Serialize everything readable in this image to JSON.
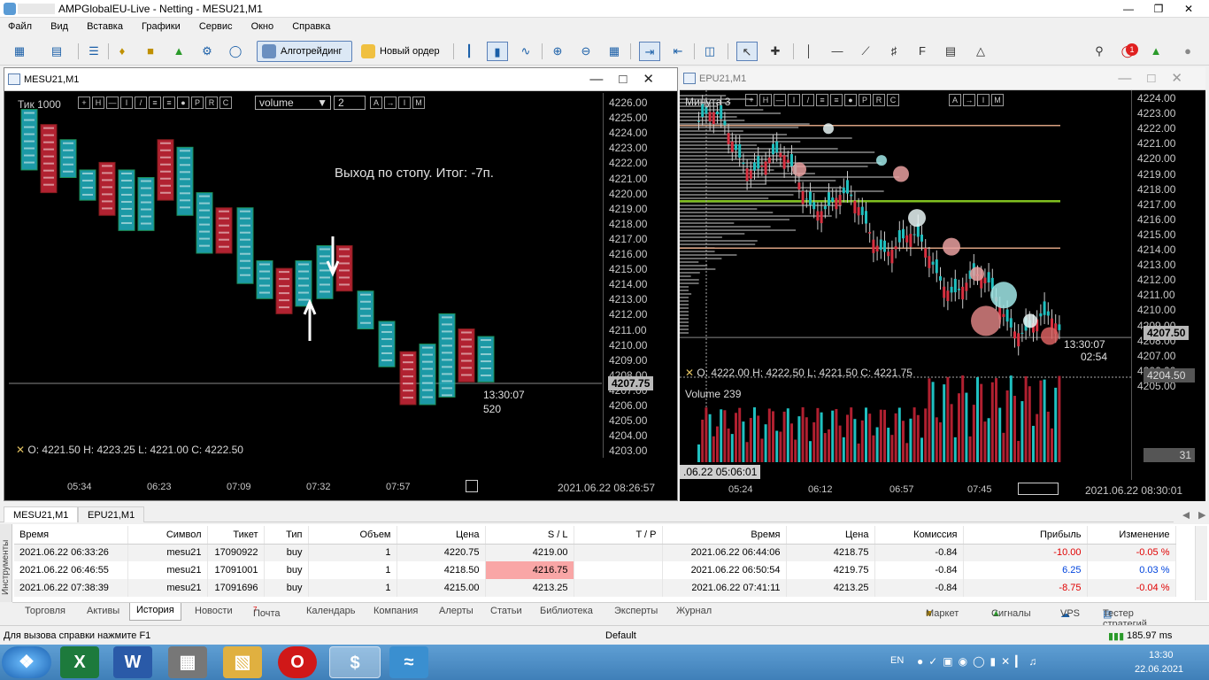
{
  "window_title": "AMPGlobalEU-Live - Netting - MESU21,M1",
  "menu": [
    "Файл",
    "Вид",
    "Вставка",
    "Графики",
    "Сервис",
    "Окно",
    "Справка"
  ],
  "toolbar": {
    "algo": "Алготрейдинг",
    "neworder": "Новый ордер"
  },
  "chart1": {
    "title": "MESU21,M1",
    "label_left": "Тик  1000",
    "indicator": "volume",
    "indicator_val": "2",
    "note": "Выход по стопу. Итог: -7п.",
    "price_axis": [
      "4226.00",
      "4225.00",
      "4224.00",
      "4223.00",
      "4222.00",
      "4221.00",
      "4220.00",
      "4219.00",
      "4218.00",
      "4217.00",
      "4216.00",
      "4215.00",
      "4214.00",
      "4213.00",
      "4212.00",
      "4211.00",
      "4210.00",
      "4209.00",
      "4208.00",
      "4207.00",
      "4206.00",
      "4205.00",
      "4204.00",
      "4203.00"
    ],
    "current_price": "4207.75",
    "countdown_time": "13:30:07",
    "countdown_ticks": "520",
    "ohlc": "O: 4221.50   H: 4223.25   L: 4221.00   C: 4222.50",
    "time_axis": [
      "05:34",
      "06:23",
      "07:09",
      "07:32",
      "07:57"
    ],
    "datetime": "2021.06.22 08:26:57"
  },
  "chart2": {
    "title": "EPU21,M1",
    "label_left": "Минута  3",
    "price_axis": [
      "4224.00",
      "4223.00",
      "4222.00",
      "4221.00",
      "4220.00",
      "4219.00",
      "4218.00",
      "4217.00",
      "4216.00",
      "4215.00",
      "4214.00",
      "4213.00",
      "4212.00",
      "4211.00",
      "4210.00",
      "4209.00",
      "4208.00",
      "4207.00",
      "4206.00",
      "4205.00"
    ],
    "current_price": "4207.50",
    "cross_price": "4204.50",
    "countdown_time": "13:30:07",
    "countdown_timer": "02:54",
    "ohlc": "O: 4222.00   H: 4222.50   L: 4221.50   C: 4221.75",
    "volume_label": "Volume 239",
    "volume_value": "31",
    "cross_time": ".06.22 05:06:01",
    "time_axis": [
      "05:24",
      "06:12",
      "06:57",
      "07:45"
    ],
    "datetime": "2021.06.22 08:30:01"
  },
  "chart_tabs": [
    "MESU21,M1",
    "EPU21,M1"
  ],
  "trades": {
    "headers": [
      "Время",
      "Символ",
      "Тикет",
      "Тип",
      "Объем",
      "Цена",
      "S / L",
      "T / P",
      "Время",
      "Цена",
      "Комиссия",
      "Прибыль",
      "Изменение"
    ],
    "rows": [
      [
        "2021.06.22 06:33:26",
        "mesu21",
        "17090922",
        "buy",
        "1",
        "4220.75",
        "4219.00",
        "",
        "2021.06.22 06:44:06",
        "4218.75",
        "-0.84",
        "-10.00",
        "-0.05 %"
      ],
      [
        "2021.06.22 06:46:55",
        "mesu21",
        "17091001",
        "buy",
        "1",
        "4218.50",
        "4216.75",
        "",
        "2021.06.22 06:50:54",
        "4219.75",
        "-0.84",
        "6.25",
        "0.03 %"
      ],
      [
        "2021.06.22 07:38:39",
        "mesu21",
        "17091696",
        "buy",
        "1",
        "4215.00",
        "4213.25",
        "",
        "2021.06.22 07:41:11",
        "4213.25",
        "-0.84",
        "-8.75",
        "-0.04 %"
      ]
    ]
  },
  "terminal_side": "Инструменты",
  "bottom_tabs": [
    "Торговля",
    "Активы",
    "История",
    "Новости",
    "Почта",
    "Календарь",
    "Компания",
    "Алерты",
    "Статьи",
    "Библиотека",
    "Эксперты",
    "Журнал"
  ],
  "mail_count": "7",
  "right_tabs": [
    "Маркет",
    "Сигналы",
    "VPS",
    "Тестер стратегий"
  ],
  "status": {
    "help": "Для вызова справки нажмите F1",
    "profile": "Default",
    "ping": "185.97 ms"
  },
  "tray": {
    "lang": "EN",
    "time": "13:30",
    "date": "22.06.2021"
  },
  "notif_count": "1",
  "colors": {
    "bull": "#21b4c4",
    "bear": "#d0293a",
    "bg": "#000000",
    "grid": "#3a3a3a"
  }
}
